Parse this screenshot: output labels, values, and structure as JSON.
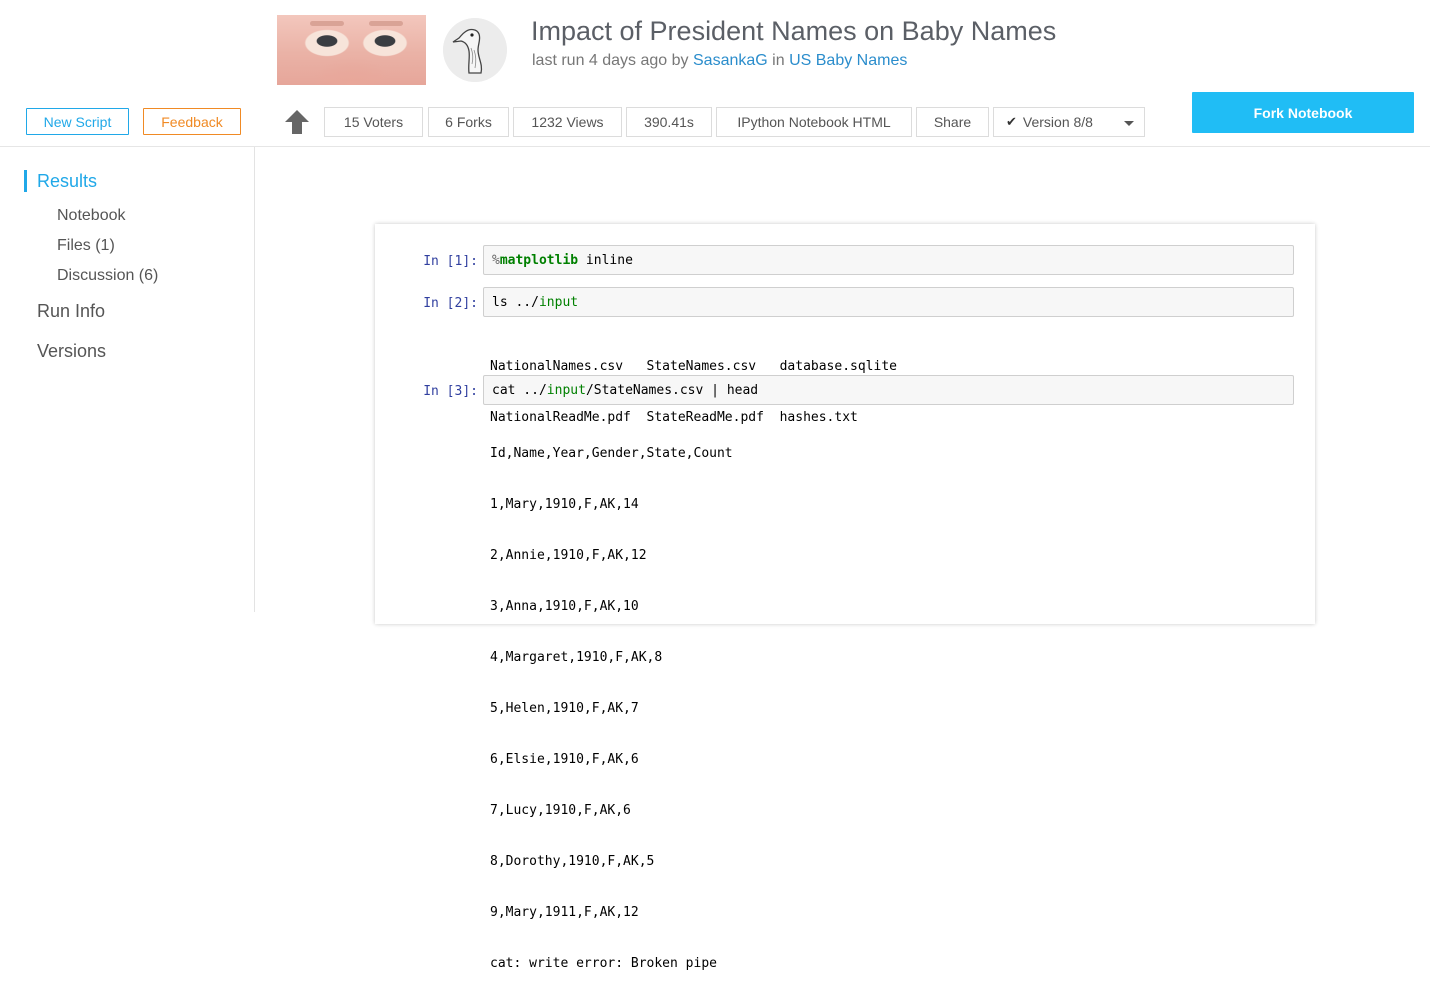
{
  "header": {
    "title": "Impact of President Names on Baby Names",
    "subtitle_prefix": "last run 4 days ago by",
    "author": "SasankaG",
    "subtitle_in": "in",
    "dataset": "US Baby Names",
    "hero_image": "baby-face-photo",
    "avatar_icon": "goose-avatar-icon"
  },
  "toolbar": {
    "new_script": "New Script",
    "feedback": "Feedback",
    "upvote_icon": "up-arrow-icon",
    "voters": "15 Voters",
    "forks": "6 Forks",
    "views": "1232 Views",
    "runtime": "390.41s",
    "format": "IPython Notebook HTML",
    "share": "Share",
    "version_check": "✔",
    "version": "Version 8/8",
    "fork_button": "Fork Notebook"
  },
  "sidebar": {
    "results": "Results",
    "notebook": "Notebook",
    "files": "Files (1)",
    "discussion": "Discussion (6)",
    "run_info": "Run Info",
    "versions": "Versions"
  },
  "cells": [
    {
      "prompt": "In [1]:",
      "code": {
        "pct": "%",
        "magic": "matplotlib",
        "rest": " inline"
      }
    },
    {
      "prompt": "In [2]:",
      "code": {
        "cmd": "ls ../",
        "module": "input"
      },
      "output": [
        "NationalNames.csv   StateNames.csv   database.sqlite",
        "NationalReadMe.pdf  StateReadMe.pdf  hashes.txt"
      ]
    },
    {
      "prompt": "In [3]:",
      "code": {
        "cmd": "cat ../",
        "module": "input",
        "rest": "/StateNames.csv | head"
      },
      "output": [
        "Id,Name,Year,Gender,State,Count",
        "1,Mary,1910,F,AK,14",
        "2,Annie,1910,F,AK,12",
        "3,Anna,1910,F,AK,10",
        "4,Margaret,1910,F,AK,8",
        "5,Helen,1910,F,AK,7",
        "6,Elsie,1910,F,AK,6",
        "7,Lucy,1910,F,AK,6",
        "8,Dorothy,1910,F,AK,5",
        "9,Mary,1911,F,AK,12",
        "cat: write error: Broken pipe"
      ]
    }
  ],
  "colors": {
    "accent": "#20a8e8",
    "feedback": "#f08a24",
    "fork": "#20bdf5",
    "prompt": "#303f9f",
    "keyword": "#008000"
  }
}
